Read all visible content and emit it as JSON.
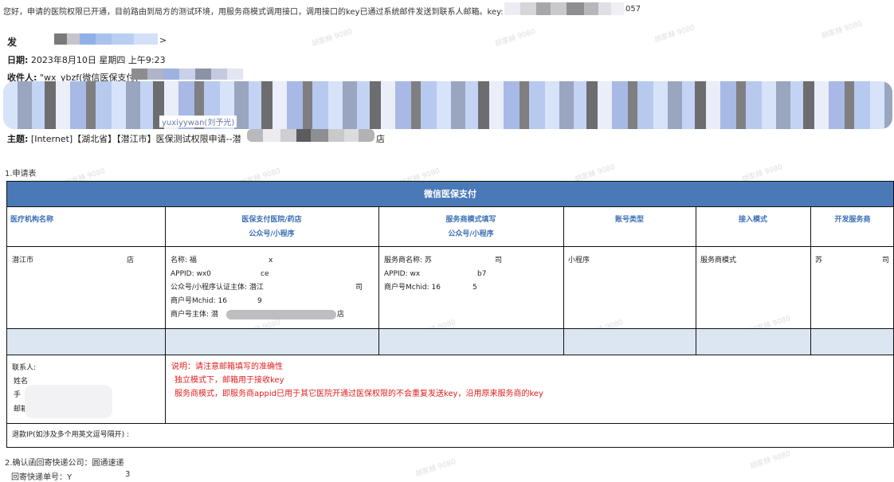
{
  "notice": "您好，申请的医院权限已开通，目前路由到局方的测试环境，用服务商模式调用接口，调用接口的key已通过系统邮件发送到联系人邮箱。key: 8b",
  "notice_tail": "057",
  "email": {
    "from_label": "发",
    "date_label": "日期:",
    "date_value": "2023年8月10日 星期四 上午9:23",
    "to_label": "收件人:",
    "to_value": "\"wx_ybzf(微信医保支付(",
    "cc_fragment": "yuxiyywan(刘予光)",
    "subject_label": "主题:",
    "subject_value": "[Internet]【湖北省】【潜江市】医保测试权限申请--潜",
    "subject_tail": "店"
  },
  "section1": "1.申请表",
  "table": {
    "title": "微信医保支付",
    "headers": {
      "org": "医疗机构名称",
      "hospital_line1": "医保支付医院/药店",
      "hospital_line2": "公众号/小程序",
      "sp_line1": "服务商模式填写",
      "sp_line2": "公众号/小程序",
      "account_type": "账号类型",
      "access_mode": "接入模式",
      "dev_sp": "开发服务商"
    },
    "row": {
      "org_name": "潜江市",
      "org_tail": "店",
      "hospital": {
        "name": "名称: 福",
        "name_tail": "x",
        "appid": "APPID: wx0",
        "appid_tail": "ce",
        "entity": "公众号/小程序认证主体: 潜江",
        "entity_tail": "司",
        "mchid": "商户号Mchid: 16",
        "mchid_tail": "9",
        "mch_entity": "商户号主体: 潜",
        "mch_entity_tail": "店"
      },
      "sp": {
        "name": "服务商名称: 苏",
        "name_tail": "司",
        "appid": "APPID: wx",
        "appid_tail": "b7",
        "mchid": "商户号Mchid: 16",
        "mchid_tail": "5"
      },
      "account_type": "小程序",
      "access_mode": "服务商模式",
      "dev_sp": "苏",
      "dev_sp_tail": "司"
    },
    "contact": {
      "label": "联系人:",
      "name": "姓名",
      "phone": "手",
      "mail": "邮箱"
    },
    "notes": [
      "说明：请注意邮箱填写的准确性",
      "独立模式下，邮箱用于接收key",
      "服务商模式，即服务商appid已用于其它医院开通过医保权限的不会重复发送key，沿用原来服务商的key"
    ],
    "refund_ip": "退款IP(如涉及多个用英文逗号隔开) :"
  },
  "section2": "2.确认函回寄快递公司：圆通速递",
  "tracking": {
    "label": "回寄快递单号：Y",
    "tail": "3"
  },
  "watermark": "胡家赫 9080",
  "colors": {
    "header_bar": "#4a79b8",
    "header_text": "#3a6fb5",
    "blue_row": "#dce6f2",
    "note_red": "#e02020"
  }
}
